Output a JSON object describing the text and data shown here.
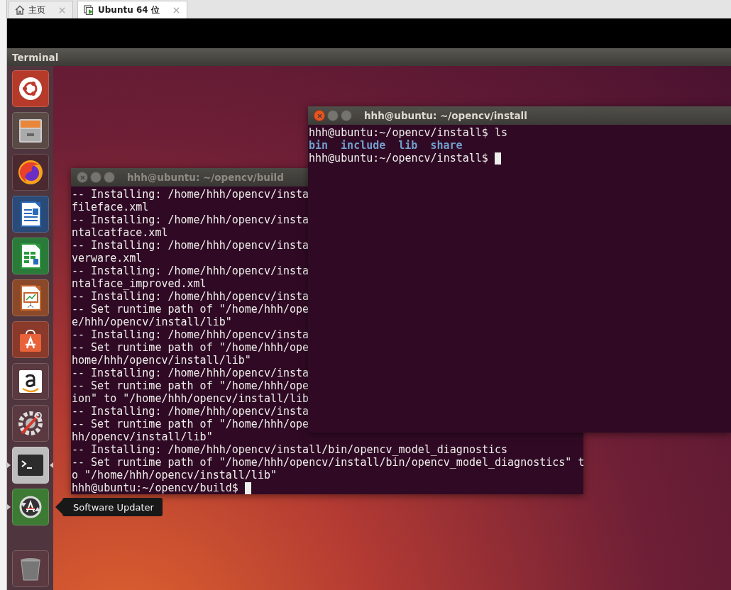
{
  "tabs": [
    {
      "label": "主页",
      "kind": "home",
      "selected": false
    },
    {
      "label": "Ubuntu 64 位",
      "kind": "vm",
      "selected": true
    }
  ],
  "top_panel": {
    "title": "Terminal"
  },
  "launcher": {
    "items": [
      {
        "kind": "ubuntu",
        "running": false,
        "focused": false
      },
      {
        "kind": "files",
        "running": false,
        "focused": false
      },
      {
        "kind": "browser",
        "running": false,
        "focused": false
      },
      {
        "kind": "writer",
        "running": false,
        "focused": false
      },
      {
        "kind": "calc",
        "running": false,
        "focused": false
      },
      {
        "kind": "impress",
        "running": false,
        "focused": false
      },
      {
        "kind": "store",
        "running": false,
        "focused": false
      },
      {
        "kind": "amazon",
        "running": false,
        "focused": false
      },
      {
        "kind": "settings",
        "running": false,
        "focused": false
      },
      {
        "kind": "terminal",
        "running": true,
        "focused": true
      },
      {
        "kind": "updater",
        "running": true,
        "focused": false
      },
      {
        "kind": "trash",
        "running": false,
        "focused": false
      }
    ]
  },
  "tooltip": "Software Updater",
  "windows": [
    {
      "title": "hhh@ubuntu: ~/opencv/build",
      "focused": false,
      "lines": [
        {
          "kind": "output",
          "text": "-- Installing: /home/hhh/opencv/insta"
        },
        {
          "kind": "output",
          "text": "fileface.xml"
        },
        {
          "kind": "output",
          "text": "-- Installing: /home/hhh/opencv/insta"
        },
        {
          "kind": "output",
          "text": "ntalcatface.xml"
        },
        {
          "kind": "output",
          "text": "-- Installing: /home/hhh/opencv/insta"
        },
        {
          "kind": "output",
          "text": "verware.xml"
        },
        {
          "kind": "output",
          "text": "-- Installing: /home/hhh/opencv/insta"
        },
        {
          "kind": "output",
          "text": "ntalface_improved.xml"
        },
        {
          "kind": "output",
          "text": "-- Installing: /home/hhh/opencv/insta"
        },
        {
          "kind": "output",
          "text": "-- Set runtime path of \"/home/hhh/ope"
        },
        {
          "kind": "output",
          "text": "e/hhh/opencv/install/lib\""
        },
        {
          "kind": "output",
          "text": "-- Installing: /home/hhh/opencv/insta"
        },
        {
          "kind": "output",
          "text": "-- Set runtime path of \"/home/hhh/ope"
        },
        {
          "kind": "output",
          "text": "home/hhh/opencv/install/lib\""
        },
        {
          "kind": "output",
          "text": "-- Installing: /home/hhh/opencv/insta"
        },
        {
          "kind": "output",
          "text": "-- Set runtime path of \"/home/hhh/ope"
        },
        {
          "kind": "output",
          "text": "ion\" to \"/home/hhh/opencv/install/lib"
        },
        {
          "kind": "output",
          "text": "-- Installing: /home/hhh/opencv/insta"
        },
        {
          "kind": "output",
          "text": "-- Set runtime path of \"/home/hhh/ope"
        },
        {
          "kind": "output",
          "text": "hh/opencv/install/lib\""
        },
        {
          "kind": "output",
          "text": "-- Installing: /home/hhh/opencv/install/bin/opencv_model_diagnostics"
        },
        {
          "kind": "output",
          "text": "-- Set runtime path of \"/home/hhh/opencv/install/bin/opencv_model_diagnostics\" t"
        },
        {
          "kind": "output",
          "text": "o \"/home/hhh/opencv/install/lib\""
        },
        {
          "kind": "prompt",
          "text": "hhh@ubuntu:~/opencv/build$",
          "cursor": true
        }
      ]
    },
    {
      "title": "hhh@ubuntu: ~/opencv/install",
      "focused": true,
      "lines": [
        {
          "kind": "prompt",
          "text": "hhh@ubuntu:~/opencv/install$ ls",
          "cursor": false
        },
        {
          "kind": "listing",
          "entries": [
            "bin",
            "include",
            "lib",
            "share"
          ]
        },
        {
          "kind": "prompt",
          "text": "hhh@ubuntu:~/opencv/install$",
          "cursor": true
        }
      ]
    }
  ]
}
